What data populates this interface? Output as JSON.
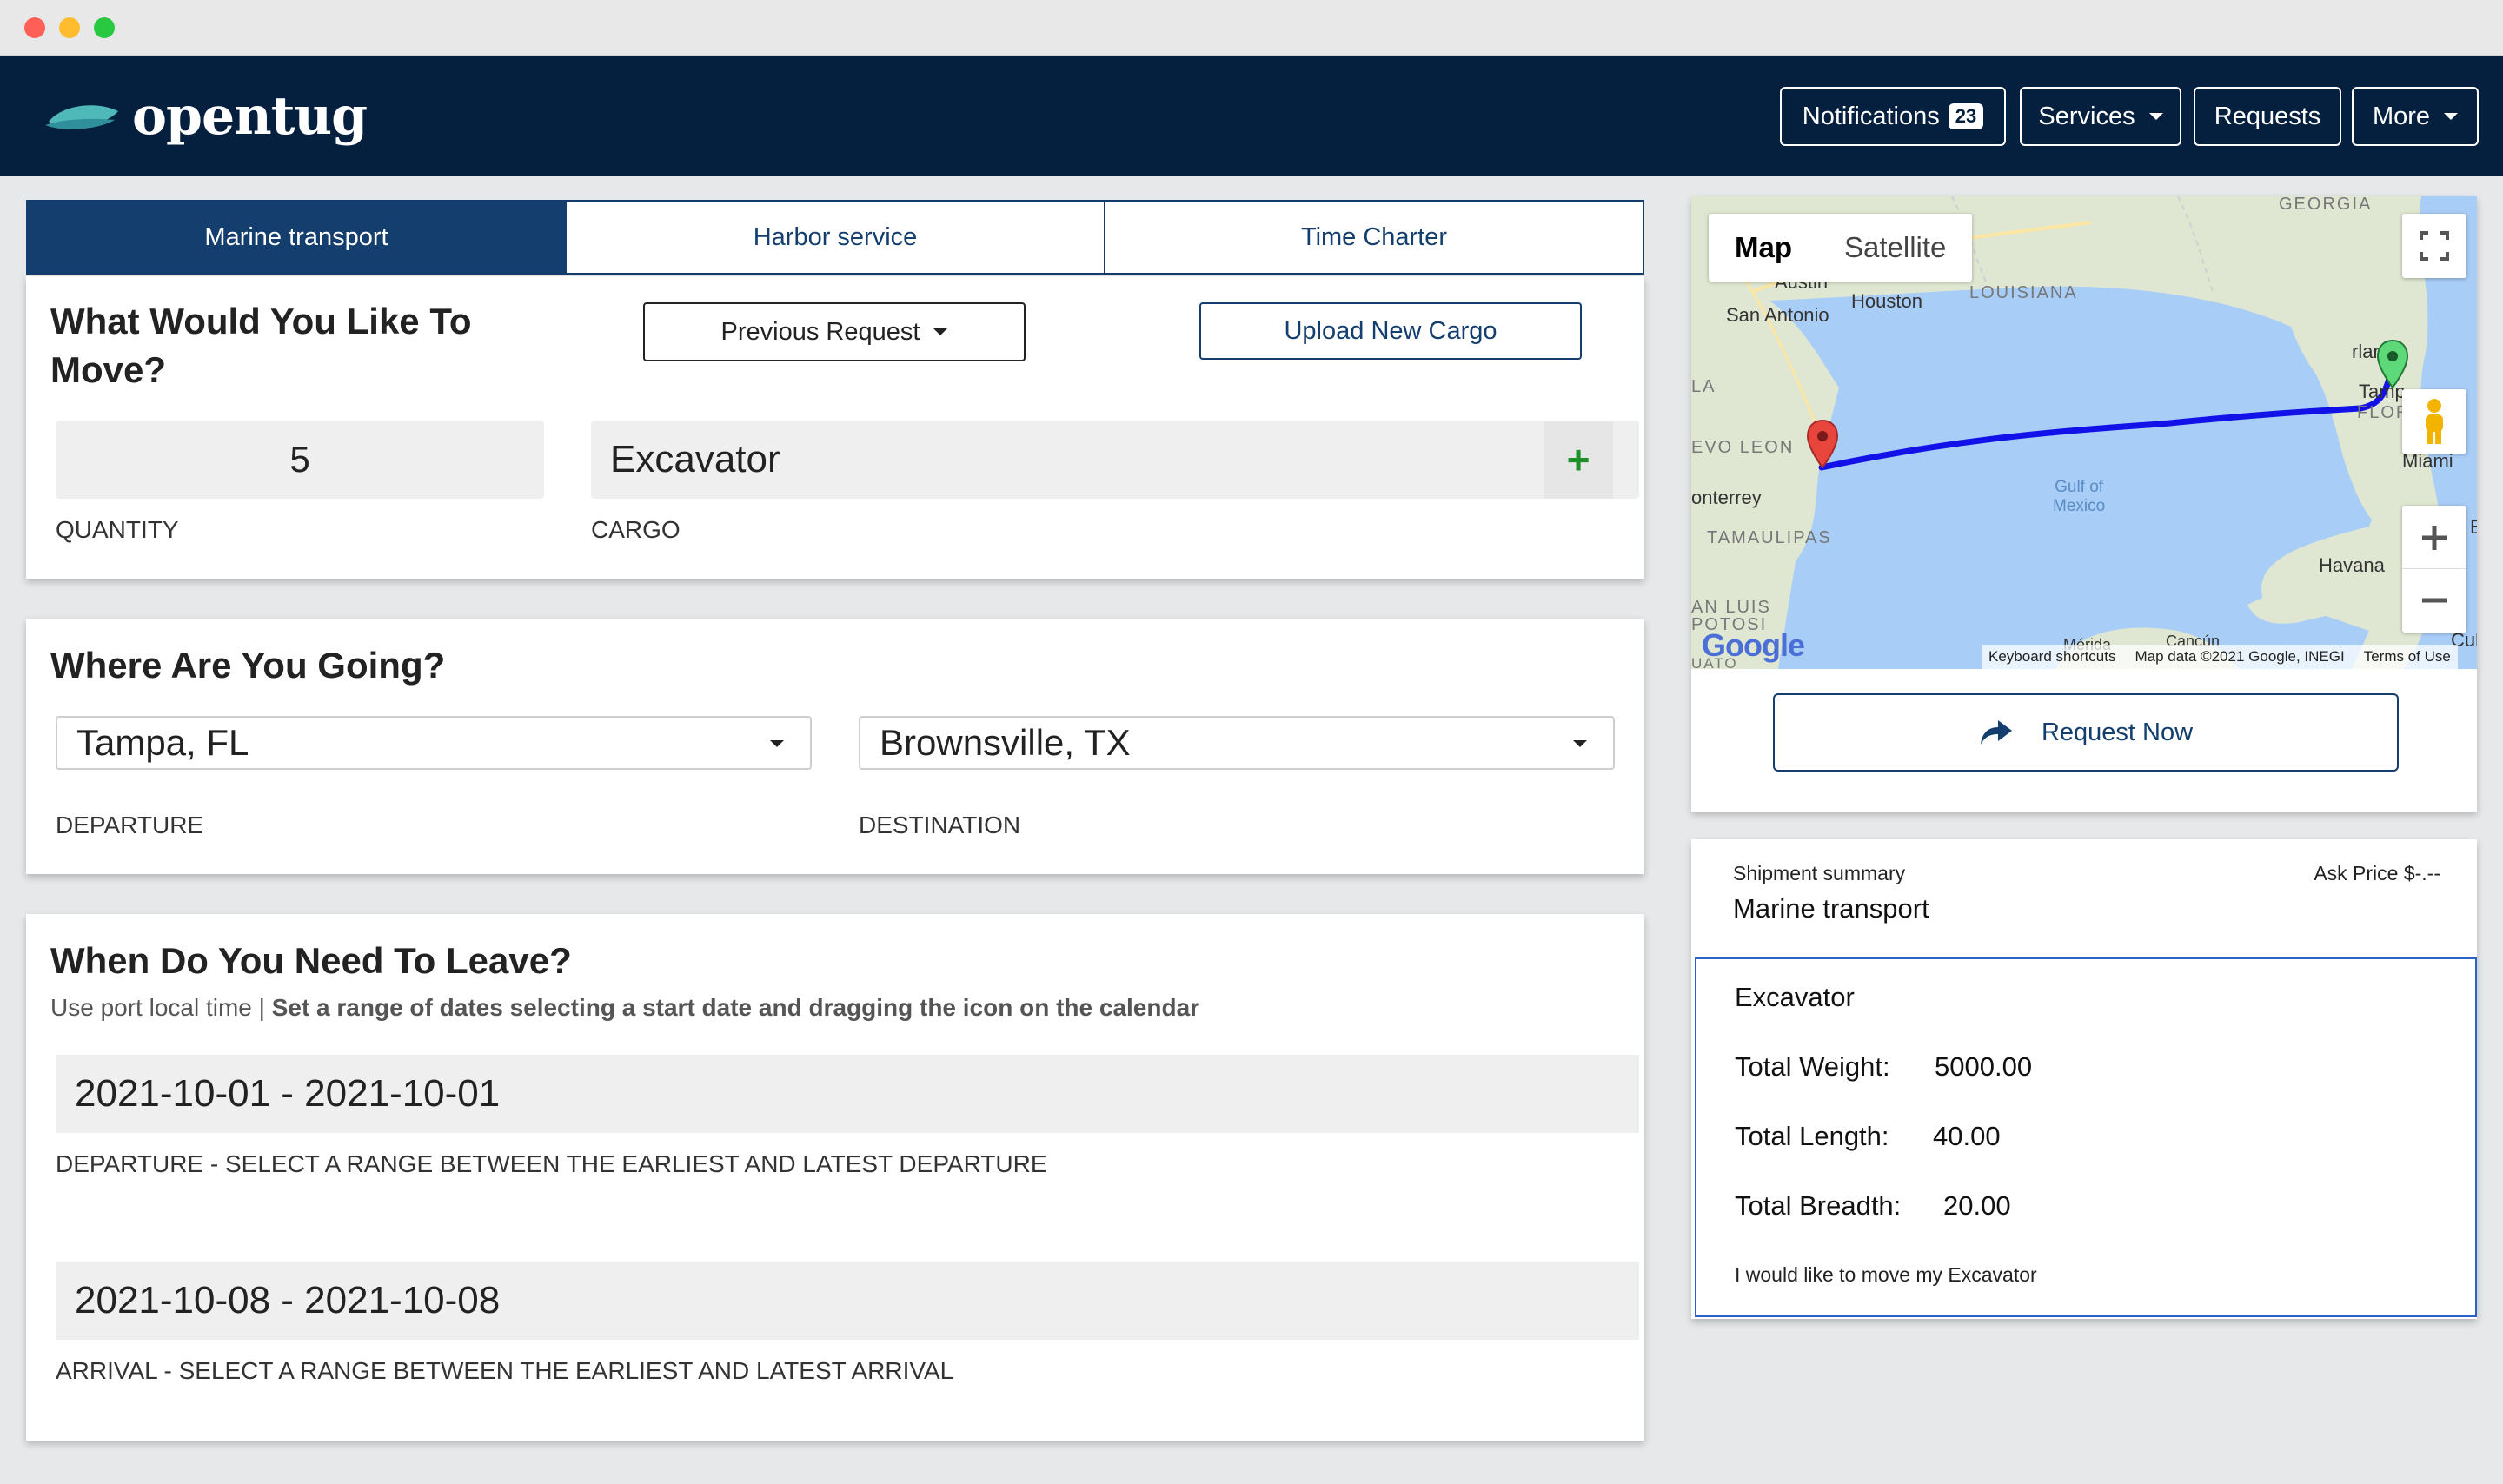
{
  "nav": {
    "brand": "opentug",
    "notifications_label": "Notifications",
    "notifications_count": "23",
    "services_label": "Services",
    "requests_label": "Requests",
    "more_label": "More"
  },
  "tabs": {
    "marine": "Marine transport",
    "harbor": "Harbor service",
    "charter": "Time Charter"
  },
  "move": {
    "title_line1": "What Would You Like To",
    "title_line2": "Move?",
    "previous_request": "Previous Request",
    "upload_cargo": "Upload New Cargo",
    "quantity_value": "5",
    "quantity_label": "QUANTITY",
    "cargo_value": "Excavator",
    "cargo_label": "CARGO",
    "add_symbol": "+"
  },
  "going": {
    "title": "Where Are You Going?",
    "departure_value": "Tampa, FL",
    "departure_label": "DEPARTURE",
    "destination_value": "Brownsville, TX",
    "destination_label": "DESTINATION"
  },
  "leave": {
    "title": "When Do You Need To Leave?",
    "hint_plain": "Use port local time | ",
    "hint_bold": "Set a range of dates selecting a start date and dragging the icon on the calendar",
    "departure_range": "2021-10-01 - 2021-10-01",
    "departure_caption": "DEPARTURE - SELECT A RANGE BETWEEN THE EARLIEST AND LATEST DEPARTURE",
    "arrival_range": "2021-10-08 - 2021-10-08",
    "arrival_caption": "ARRIVAL - SELECT A RANGE BETWEEN THE EARLIEST AND LATEST ARRIVAL"
  },
  "map": {
    "type_map": "Map",
    "type_satellite": "Satellite",
    "labels": {
      "georgia": "GEORGIA",
      "louisiana": "LOUISIANA",
      "austin": "Austin",
      "houston": "Houston",
      "san_antonio": "San Antonio",
      "orlando": "rlando",
      "tampa": "Tamp",
      "flor": "FLOR",
      "la": "LA",
      "nuevo_leon": "EVO LEON",
      "monterrey": "onterrey",
      "tamaulipas": "TAMAULIPAS",
      "miami": "Miami",
      "gulf": "Gulf of",
      "mexico": "Mexico",
      "havana": "Havana",
      "san_luis": "AN LUIS",
      "potosi": "POTOSI",
      "cancun": "Cancún",
      "merida": "Mérida",
      "cu": "Cul",
      "b": "B",
      "guanajuato": "UATO"
    },
    "google": "Google",
    "keyboard": "Keyboard shortcuts",
    "map_data": "Map data ©2021 Google, INEGI",
    "terms": "Terms of Use"
  },
  "request_now": "Request Now",
  "summary": {
    "label": "Shipment summary",
    "ask_price": "Ask Price $-.--",
    "service": "Marine transport",
    "cargo": "Excavator",
    "weight_label": "Total Weight:",
    "weight_value": "5000.00",
    "length_label": "Total Length:",
    "length_value": "40.00",
    "breadth_label": "Total Breadth:",
    "breadth_value": "20.00",
    "note": "I would like to move my Excavator"
  },
  "colors": {
    "navbar": "#04203e",
    "primary": "#133e6e",
    "route": "#1212e8",
    "add": "#1f8f2a"
  }
}
